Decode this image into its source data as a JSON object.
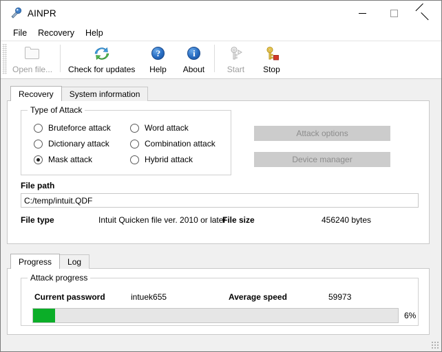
{
  "window": {
    "title": "AINPR",
    "icon": "app-key-icon",
    "controls": {
      "minimize": "minimize-icon",
      "maximize": "maximize-icon",
      "close": "close-icon"
    }
  },
  "menubar": {
    "items": [
      {
        "label": "File"
      },
      {
        "label": "Recovery"
      },
      {
        "label": "Help"
      }
    ]
  },
  "toolbar": {
    "buttons": [
      {
        "label": "Open file...",
        "icon": "folder-open-icon",
        "enabled": false
      },
      {
        "label": "Check for updates",
        "icon": "refresh-icon",
        "enabled": true
      },
      {
        "label": "Help",
        "icon": "question-circle-icon",
        "enabled": true
      },
      {
        "label": "About",
        "icon": "info-circle-icon",
        "enabled": true
      },
      {
        "label": "Start",
        "icon": "key-play-icon",
        "enabled": false
      },
      {
        "label": "Stop",
        "icon": "key-stop-icon",
        "enabled": true
      }
    ]
  },
  "main_tabs": {
    "tabs": [
      {
        "label": "Recovery",
        "active": true
      },
      {
        "label": "System information",
        "active": false
      }
    ]
  },
  "attack": {
    "group_title": "Type of Attack",
    "options": [
      {
        "label": "Bruteforce attack",
        "checked": false
      },
      {
        "label": "Dictionary attack",
        "checked": false
      },
      {
        "label": "Mask attack",
        "checked": true
      },
      {
        "label": "Word attack",
        "checked": false
      },
      {
        "label": "Combination attack",
        "checked": false
      },
      {
        "label": "Hybrid attack",
        "checked": false
      }
    ],
    "buttons": [
      {
        "label": "Attack options",
        "enabled": false
      },
      {
        "label": "Device manager",
        "enabled": false
      }
    ]
  },
  "file_info": {
    "path_label": "File path",
    "path_value": "C:/temp/intuit.QDF",
    "type_label": "File type",
    "type_value": "Intuit Quicken file ver. 2010 or later",
    "size_label": "File size",
    "size_value": "456240 bytes"
  },
  "bottom_tabs": {
    "tabs": [
      {
        "label": "Progress",
        "active": true
      },
      {
        "label": "Log",
        "active": false
      }
    ]
  },
  "progress": {
    "group_title": "Attack progress",
    "current_password_label": "Current password",
    "current_password_value": "intuek655",
    "average_speed_label": "Average speed",
    "average_speed_value": "59973",
    "percent_label": "6%",
    "percent_value": 6
  },
  "colors": {
    "progress_fill": "#0bae28",
    "accent_blue": "#2a6fc4",
    "key_gold": "#e8c44a",
    "stop_red": "#d43a2a",
    "disabled_text": "#9d9d9d"
  }
}
